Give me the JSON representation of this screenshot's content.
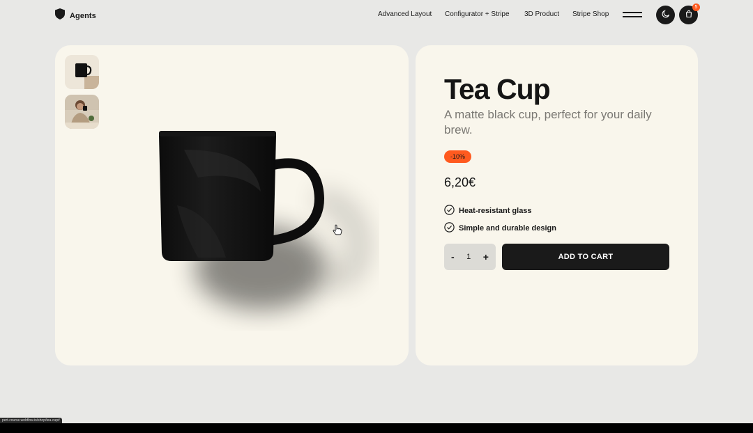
{
  "header": {
    "brand": "Agents",
    "nav": [
      "Advanced Layout",
      "Configurator + Stripe",
      "3D Product",
      "Stripe Shop"
    ],
    "cart_count": "5"
  },
  "product": {
    "title": "Tea Cup",
    "subtitle": "A matte black cup, perfect for your daily brew.",
    "badge": "-10%",
    "price": "6,20€",
    "features": [
      "Heat-resistant glass",
      "Simple and durable design"
    ],
    "quantity": "1",
    "minus": "-",
    "plus": "+",
    "add_to_cart": "ADD TO CART"
  },
  "status_url": "pert-course.webflow.io/shop/tea-cup#",
  "colors": {
    "accent": "#ff5a1f",
    "panel": "#f9f6ec",
    "dark": "#1a1a1a",
    "background": "#e8e8e6"
  },
  "icons": [
    "shield-logo-icon",
    "hamburger-menu-icon",
    "moon-icon",
    "cart-icon",
    "check-circle-icon",
    "hand-cursor-icon"
  ]
}
